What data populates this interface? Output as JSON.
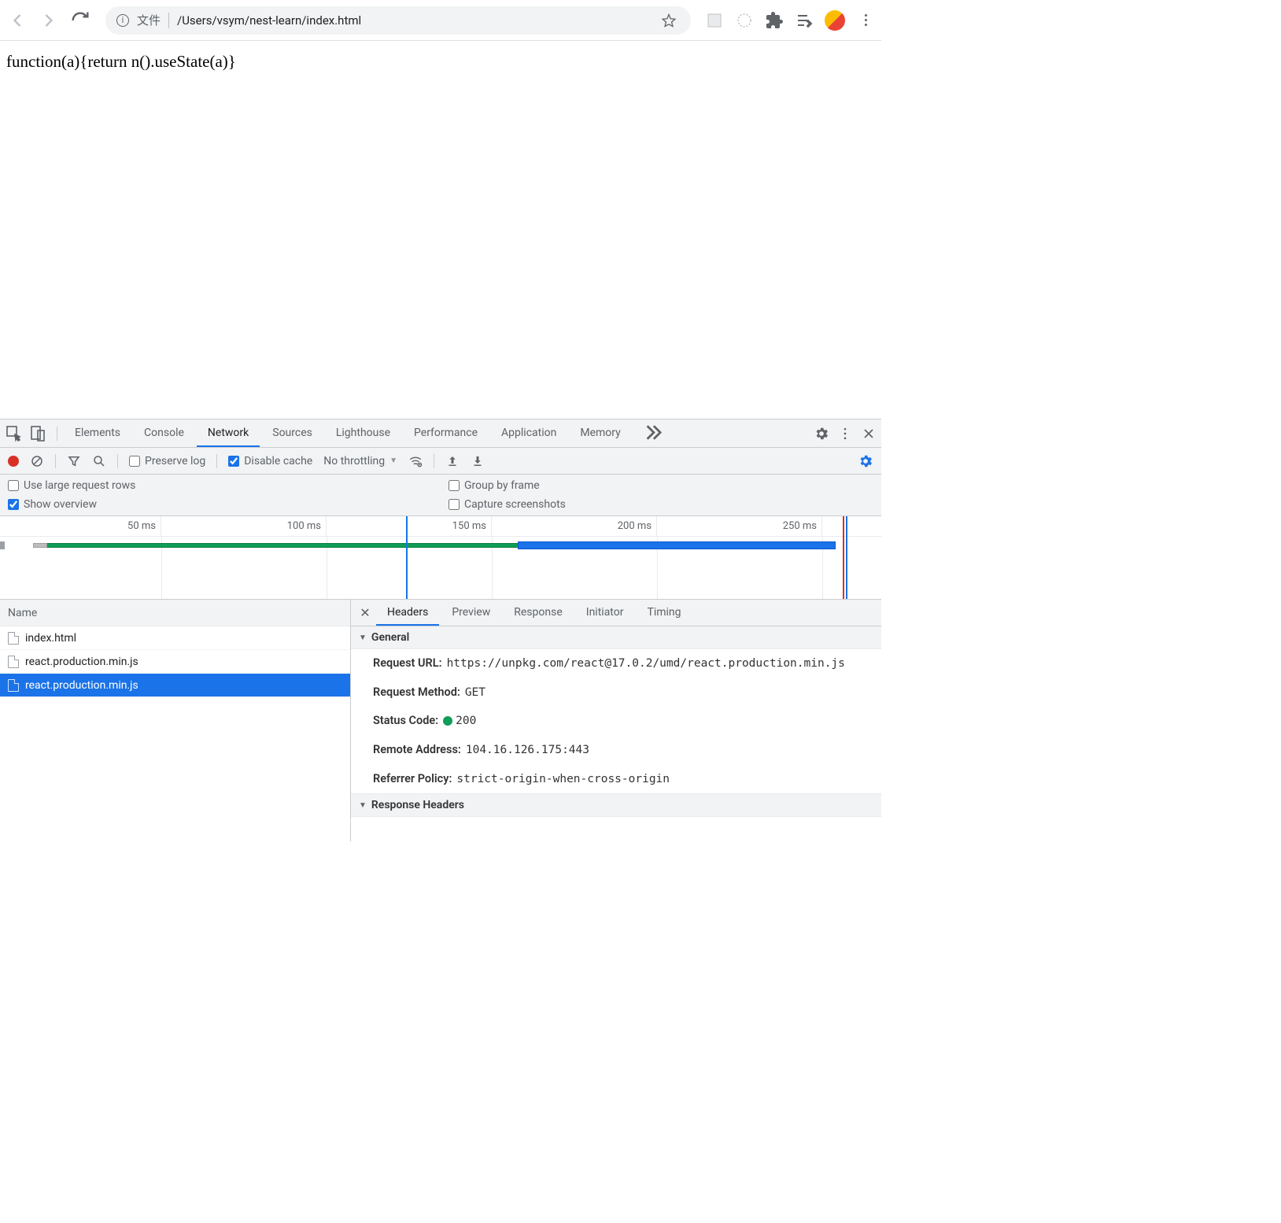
{
  "browser": {
    "url_label": "文件",
    "url_path": "/Users/vsym/nest-learn/index.html"
  },
  "page": {
    "body_text": "function(a){return n().useState(a)}"
  },
  "devtools": {
    "tabs": [
      "Elements",
      "Console",
      "Network",
      "Sources",
      "Lighthouse",
      "Performance",
      "Application",
      "Memory"
    ],
    "active_tab": "Network",
    "network_toolbar": {
      "preserve_log_label": "Preserve log",
      "preserve_log_checked": false,
      "disable_cache_label": "Disable cache",
      "disable_cache_checked": true,
      "throttling": "No throttling"
    },
    "options": {
      "large_rows_label": "Use large request rows",
      "large_rows_checked": false,
      "show_overview_label": "Show overview",
      "show_overview_checked": true,
      "group_by_frame_label": "Group by frame",
      "group_by_frame_checked": false,
      "capture_screenshots_label": "Capture screenshots",
      "capture_screenshots_checked": false
    },
    "timeline": {
      "ticks": [
        "50 ms",
        "100 ms",
        "150 ms",
        "200 ms",
        "250 ms"
      ]
    },
    "request_list": {
      "header": "Name",
      "rows": [
        "index.html",
        "react.production.min.js",
        "react.production.min.js"
      ],
      "selected_index": 2
    },
    "detail": {
      "tabs": [
        "Headers",
        "Preview",
        "Response",
        "Initiator",
        "Timing"
      ],
      "active_tab": "Headers",
      "general_label": "General",
      "response_headers_label": "Response Headers",
      "general": {
        "request_url_k": "Request URL:",
        "request_url_v": "https://unpkg.com/react@17.0.2/umd/react.production.min.js",
        "request_method_k": "Request Method:",
        "request_method_v": "GET",
        "status_code_k": "Status Code:",
        "status_code_v": "200",
        "remote_address_k": "Remote Address:",
        "remote_address_v": "104.16.126.175:443",
        "referrer_policy_k": "Referrer Policy:",
        "referrer_policy_v": "strict-origin-when-cross-origin"
      }
    }
  }
}
